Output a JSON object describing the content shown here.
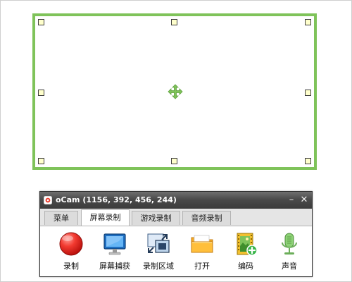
{
  "window": {
    "title": "oCam (1156, 392, 456, 244)"
  },
  "tabs": [
    {
      "label": "菜单",
      "active": false
    },
    {
      "label": "屏幕录制",
      "active": true
    },
    {
      "label": "游戏录制",
      "active": false
    },
    {
      "label": "音频录制",
      "active": false
    }
  ],
  "toolbar": {
    "items": [
      {
        "label": "录制",
        "icon": "record-icon"
      },
      {
        "label": "屏幕捕获",
        "icon": "monitor-icon"
      },
      {
        "label": "录制区域",
        "icon": "region-icon"
      },
      {
        "label": "打开",
        "icon": "folder-icon"
      },
      {
        "label": "编码",
        "icon": "film-add-icon"
      },
      {
        "label": "声音",
        "icon": "microphone-icon"
      }
    ]
  },
  "colors": {
    "selection_border": "#7fc35a",
    "handle_fill": "#ffffcc",
    "titlebar": "#444444"
  }
}
